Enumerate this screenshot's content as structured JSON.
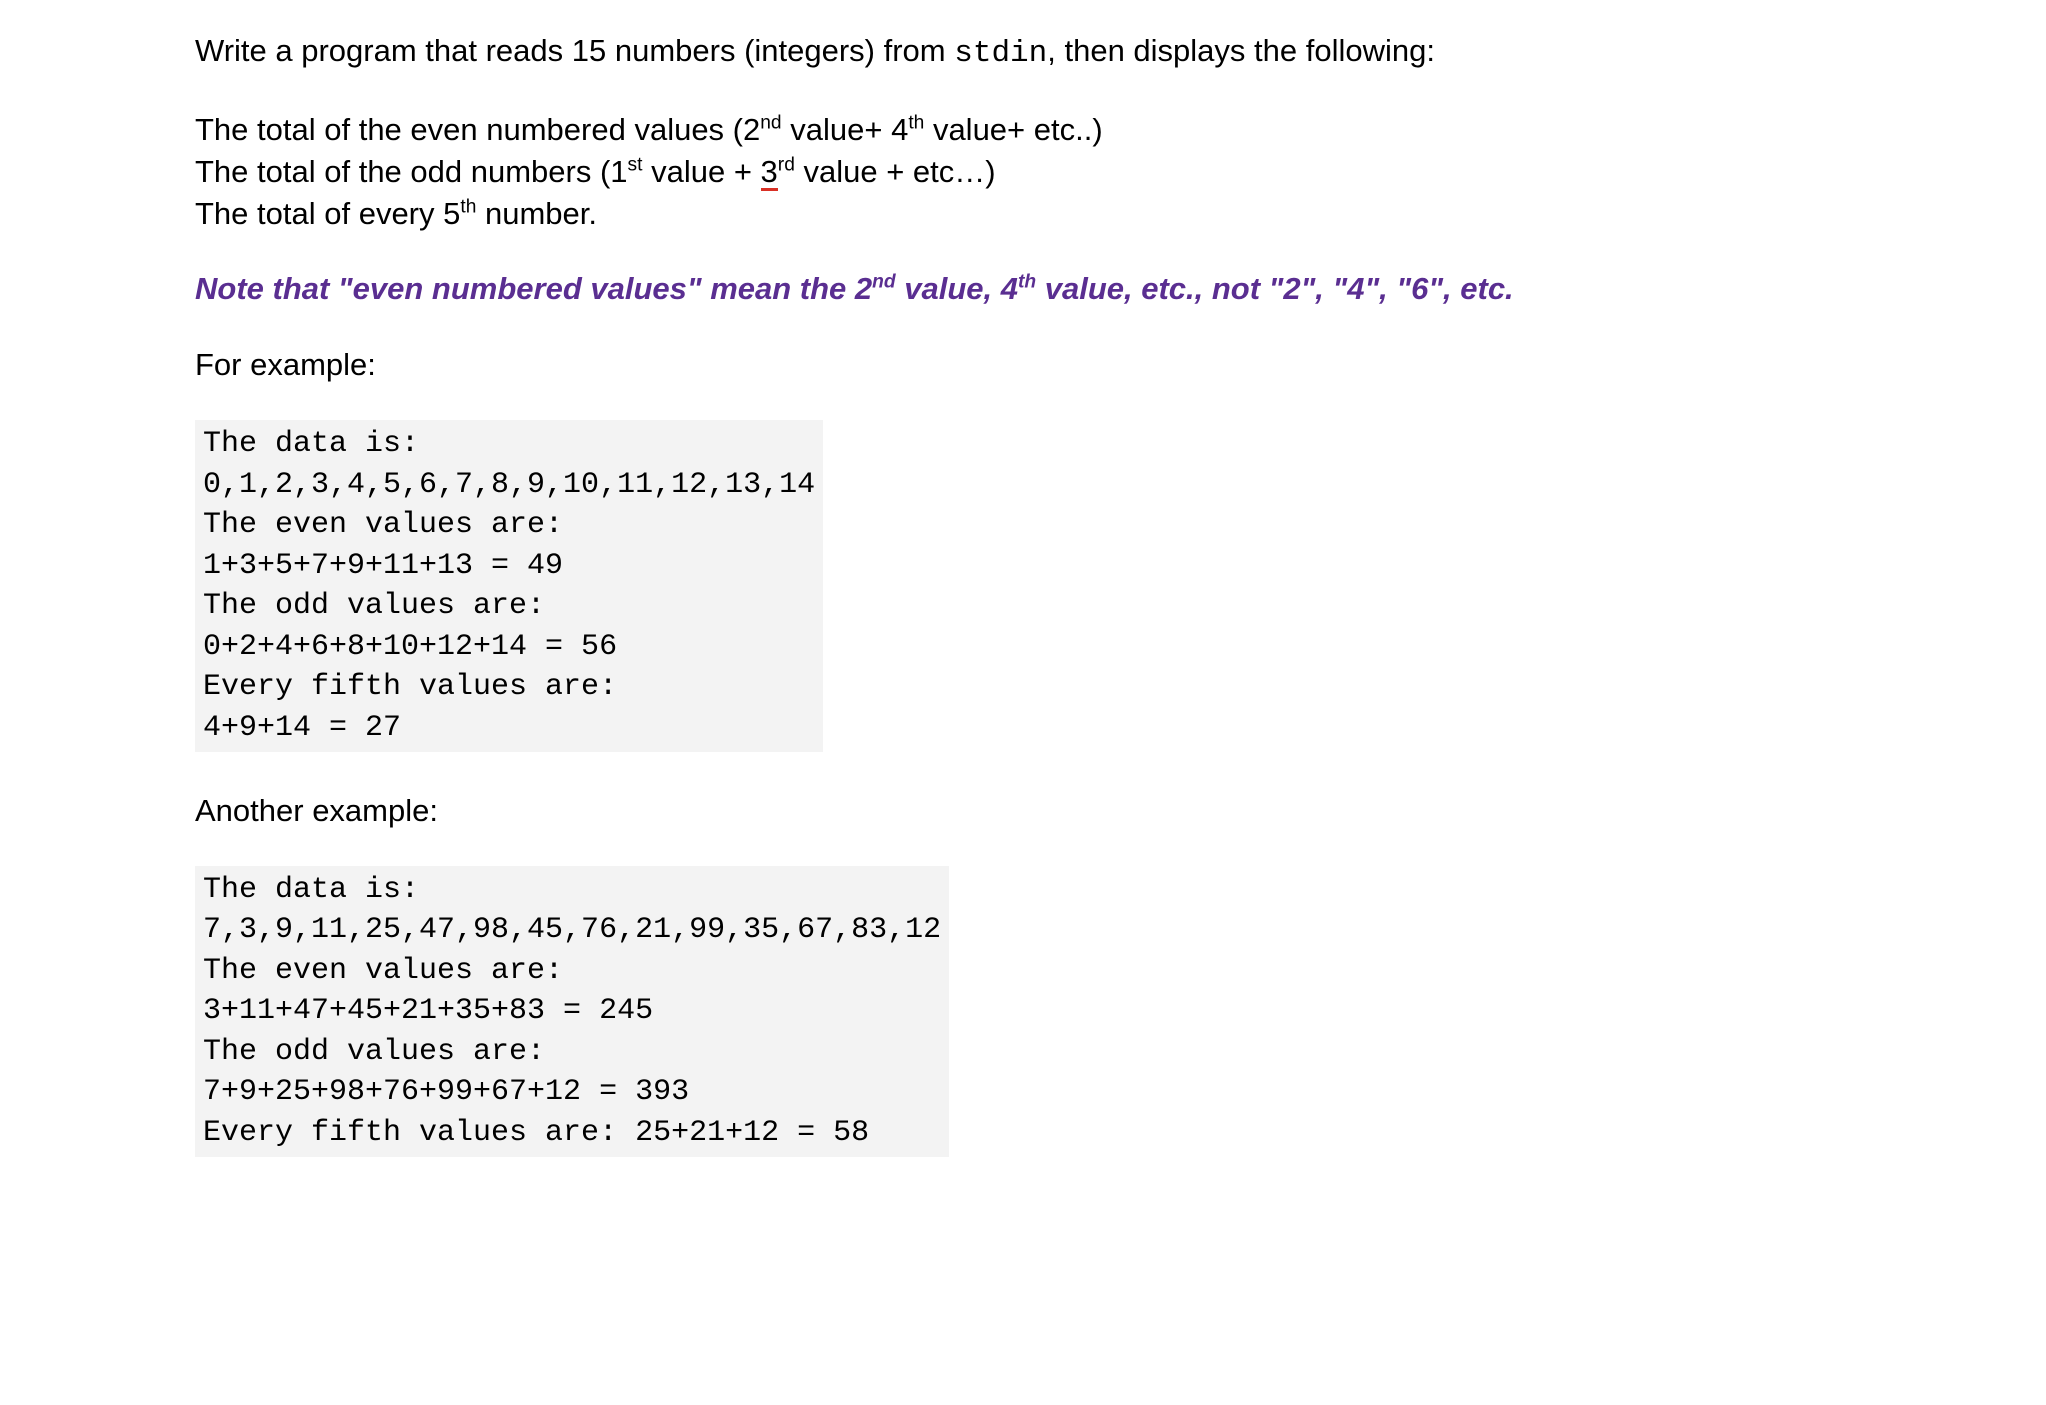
{
  "intro": {
    "line1_pre": "Write a program that reads 15 numbers (integers) from ",
    "line1_mono": "stdin",
    "line1_post": ", then displays the following:"
  },
  "list": {
    "even": {
      "pre": "The total of the even numbered values (2",
      "sup1": "nd",
      "mid1": " value+ 4",
      "sup2": "th",
      "post": " value+ etc..)"
    },
    "odd": {
      "pre": "The total of the odd numbers (1",
      "sup1": "st",
      "mid1": " value + ",
      "three": "3",
      "sup2": "rd",
      "post": " value + etc…)"
    },
    "fifth": {
      "pre": "The total of every 5",
      "sup1": "th",
      "post": " number."
    }
  },
  "note": {
    "pre": "Note that \"even numbered values\" mean the 2",
    "sup1": "nd",
    "mid1": " value, 4",
    "sup2": "th",
    "post": " value, etc., not \"2\", \"4\", \"6\", etc."
  },
  "example1_label": "For example:",
  "example1_code": "The data is:\n0,1,2,3,4,5,6,7,8,9,10,11,12,13,14\nThe even values are:\n1+3+5+7+9+11+13 = 49\nThe odd values are:\n0+2+4+6+8+10+12+14 = 56\nEvery fifth values are:\n4+9+14 = 27",
  "example2_label": "Another example:",
  "example2_code": "The data is:\n7,3,9,11,25,47,98,45,76,21,99,35,67,83,12\nThe even values are:\n3+11+47+45+21+35+83 = 245\nThe odd values are:\n7+9+25+98+76+99+67+12 = 393\nEvery fifth values are: 25+21+12 = 58"
}
